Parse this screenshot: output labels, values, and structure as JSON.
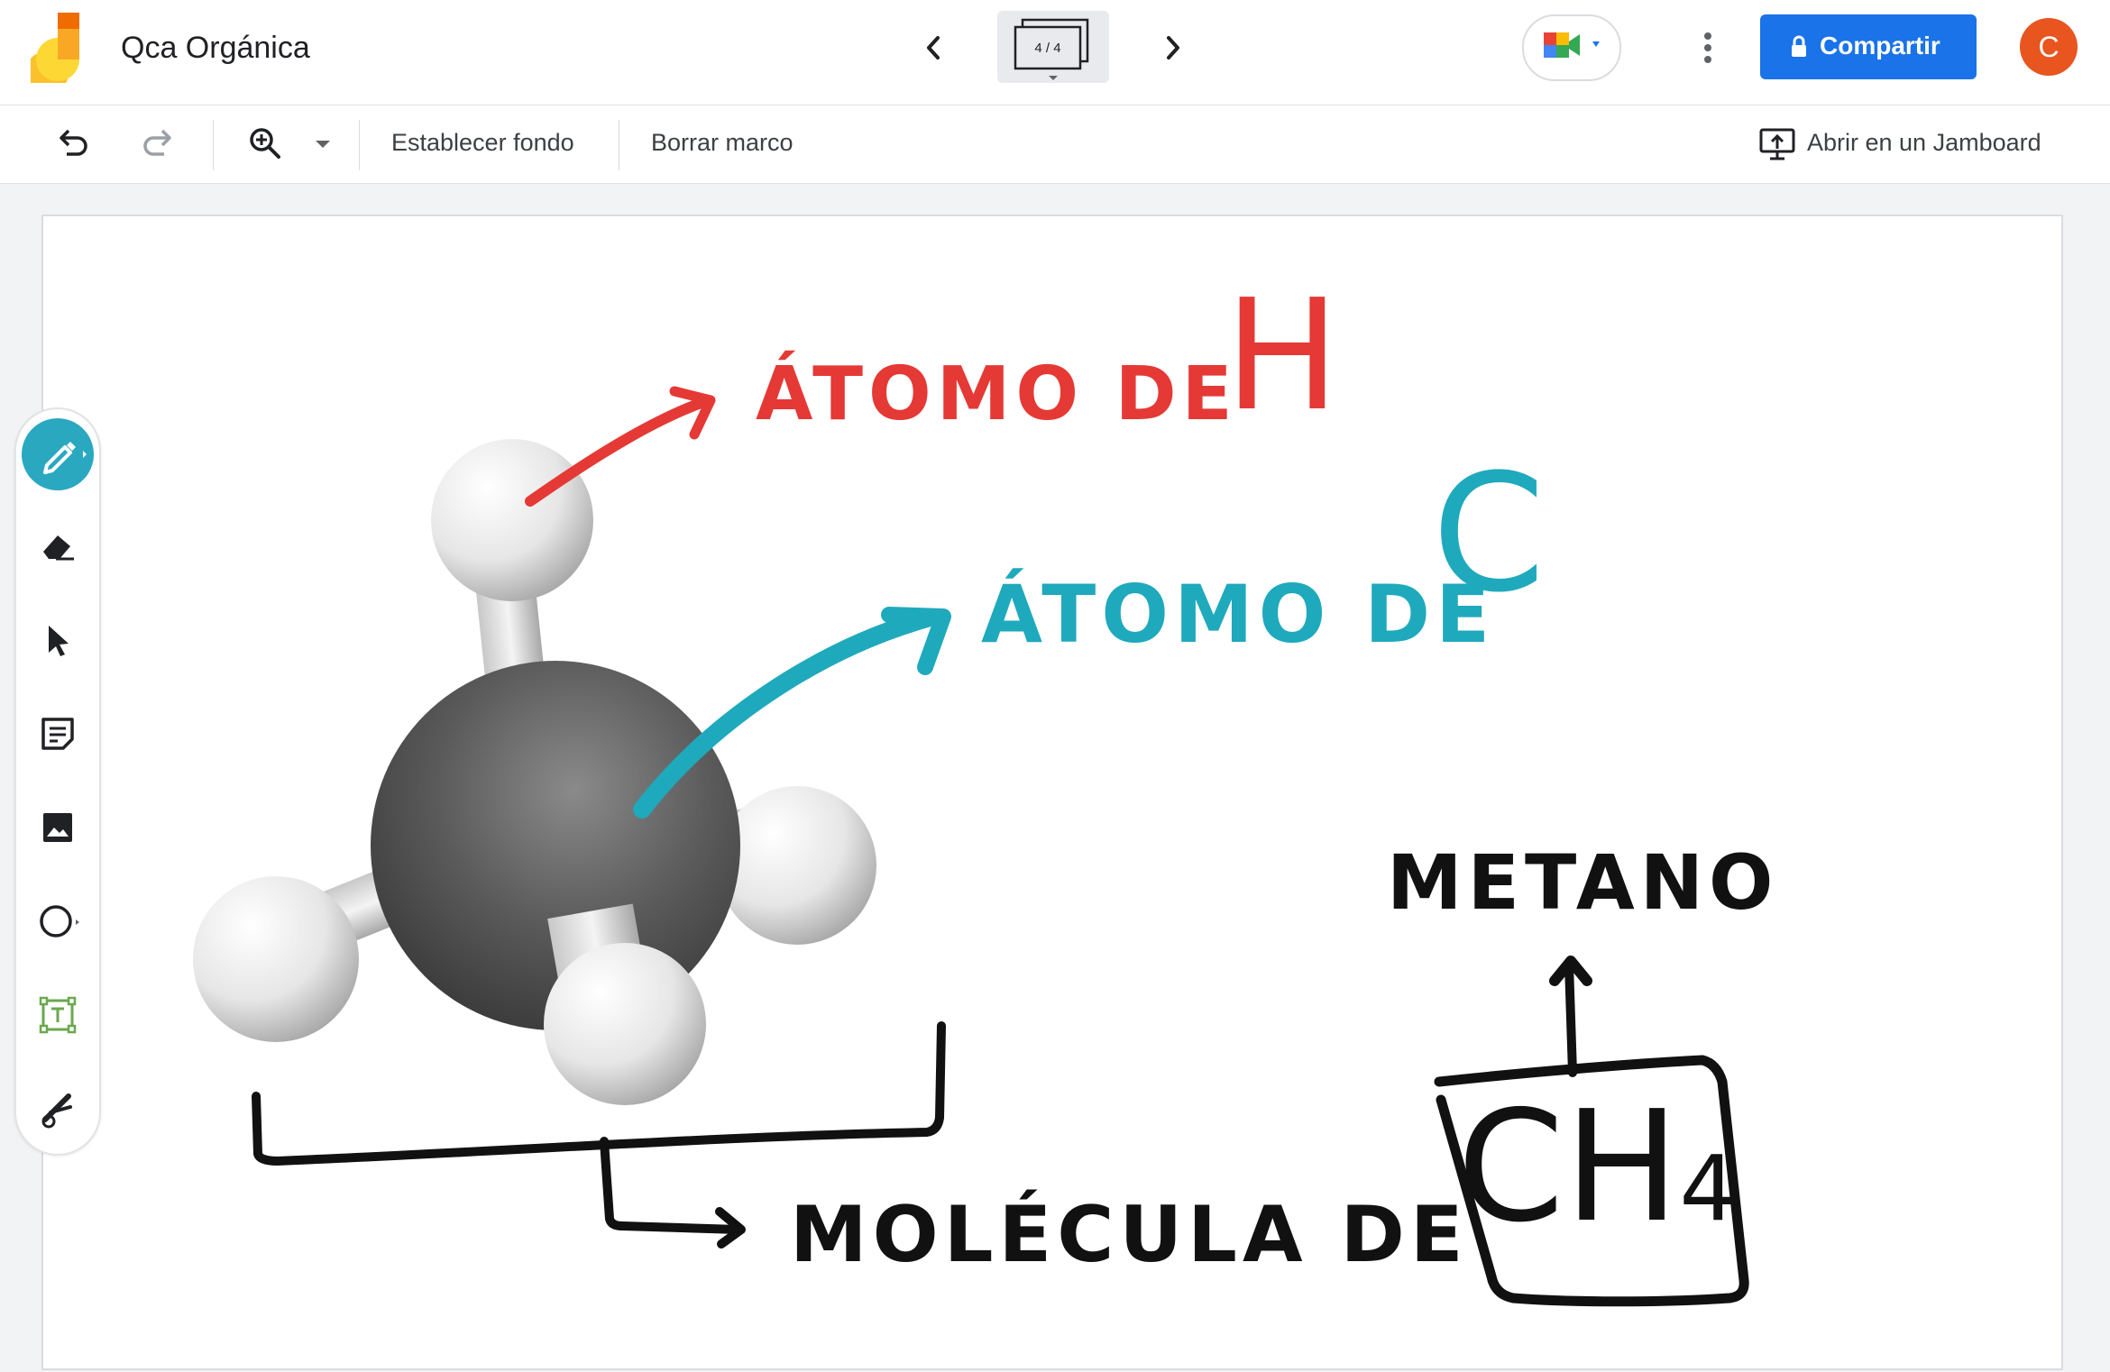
{
  "app": {
    "title": "Qca Orgánica",
    "frame_counter": "4 / 4",
    "share_label": "Compartir",
    "avatar_letter": "C"
  },
  "toolbar": {
    "set_background": "Establecer fondo",
    "clear_frame": "Borrar marco",
    "open_in_jamboard": "Abrir en un Jamboard"
  },
  "board": {
    "hydrogen_label_prefix": "ÁTOMO DE",
    "hydrogen_symbol": "H",
    "carbon_label_prefix": "ÁTOMO DE",
    "carbon_symbol": "C",
    "methane_label": "METANO",
    "molecule_label": "MOLÉCULA DE",
    "formula": "CH",
    "formula_subscript": "4",
    "colors": {
      "hydrogen_annotation": "#e53935",
      "carbon_annotation": "#1fa9bd",
      "black_ink": "#111111"
    }
  },
  "side_tools": [
    "pen-tool",
    "eraser-tool",
    "select-tool",
    "sticky-note-tool",
    "image-tool",
    "shape-tool",
    "text-box-tool",
    "laser-tool"
  ]
}
